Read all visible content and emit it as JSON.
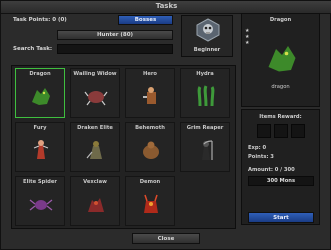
{
  "window": {
    "title": "Tasks",
    "close_label": "Close"
  },
  "left": {
    "task_points_label": "Task Points: 0 (0)",
    "category_button": "Bosses",
    "rank_button": "Hunter (80)",
    "search_label": "Search Task:",
    "search_value": ""
  },
  "rank": {
    "label": "Beginner"
  },
  "tiles": [
    {
      "name": "Dragon"
    },
    {
      "name": "Wailing Widow"
    },
    {
      "name": "Hero"
    },
    {
      "name": "Hydra"
    },
    {
      "name": "Fury"
    },
    {
      "name": "Draken Elite"
    },
    {
      "name": "Behemoth"
    },
    {
      "name": "Grim Reaper"
    },
    {
      "name": "Elite Spider"
    },
    {
      "name": "Vexclaw"
    },
    {
      "name": "Demon"
    }
  ],
  "right": {
    "title": "Dragon",
    "subtitle": "dragon",
    "items_reward_label": "Items Reward:",
    "exp_label": "Exp: 0",
    "points_label": "Points: 3",
    "amount_label": "Amount: 0 / 300",
    "amount_box": "300 Mons",
    "start_label": "Start"
  },
  "colors": {
    "accent_blue": "#2f5fb8",
    "selection_green": "#3fbf3f"
  }
}
